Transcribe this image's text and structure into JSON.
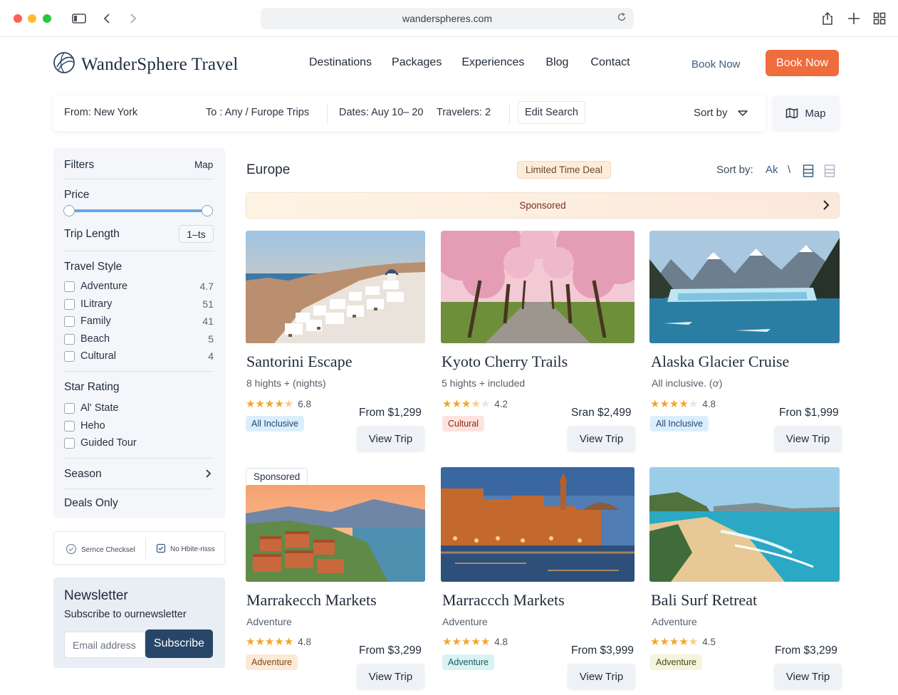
{
  "browser": {
    "url": "wanderspheres.com"
  },
  "header": {
    "logo_text": "WanderSphere Travel",
    "nav": [
      "Destinations",
      "Packages",
      "Experiences",
      "Blog",
      "Contact"
    ],
    "book_link": "Book Now",
    "book_button": "Book Now"
  },
  "search": {
    "from": "From: New York",
    "to": "To : Any / Furope Trips",
    "dates": "Dates:  Auy 10– 20",
    "travelers": "Travelers: 2",
    "edit": "Edit Search",
    "sort": "Sort by",
    "map": "Map"
  },
  "sidebar": {
    "filters": "Filters",
    "map_link": "Map",
    "price": "Price",
    "trip_length": "Trip Length",
    "trip_length_value": "1–ts",
    "travel_style": "Travel Style",
    "styles": [
      {
        "label": "Adventure",
        "count": "4.7"
      },
      {
        "label": "ILitrary",
        "count": "51"
      },
      {
        "label": "Family",
        "count": "41"
      },
      {
        "label": "Beach",
        "count": "5"
      },
      {
        "label": "Cultural",
        "count": "4"
      }
    ],
    "star_rating": "Star Rating",
    "ratings": [
      "Al' State",
      "Heho",
      "Guided Tour"
    ],
    "season": "Season",
    "deals_only": "Deals Only"
  },
  "trust": {
    "left": "Sernce Checksel",
    "right": "No Hbite-risss"
  },
  "newsletter": {
    "title": "Newsletter",
    "subtitle": "Subscribe to ournewsletter",
    "placeholder": "Email address",
    "button": "Subscribe"
  },
  "main": {
    "region": "Europe",
    "deal": "Limited Time Deal",
    "sort_label": "Sort by:",
    "sort_value": "Ak",
    "sort_slash": "\\",
    "sponsored_banner": "Sponsored",
    "sponsored_tab": "Sponsored"
  },
  "cards": [
    {
      "title": "Santorini Escape",
      "sub": "8 hights + (nights)",
      "rating": 4.5,
      "rating_text": "6.8",
      "price": "From $1,299",
      "tag": "All  Inclusive",
      "tag_color": "blue",
      "button": "View Trip"
    },
    {
      "title": "Kyoto Cherry Trails",
      "sub": "5 hights  + included",
      "rating": 3.5,
      "rating_text": "4.2",
      "price": "Sran $2,499",
      "tag": "Cultural",
      "tag_color": "red",
      "button": "View Trip"
    },
    {
      "title": "Alaska Glacier Cruise",
      "sub": "All inclusive.   (ơ)",
      "rating": 4,
      "rating_text": "4.8",
      "price": "Fron $1,999",
      "tag": "All  Inclusive",
      "tag_color": "blue",
      "button": "View Trip"
    },
    {
      "title": "Marrakecch Markets",
      "sub": "Adventure",
      "rating": 5,
      "rating_text": "4.8",
      "price": "From $3,299",
      "tag": "Adventure",
      "tag_color": "orange",
      "button": "View Trip"
    },
    {
      "title": "Marraccch Markets",
      "sub": "Adventure",
      "rating": 5,
      "rating_text": "4.8",
      "price": "From $3,999",
      "tag": "Adventure",
      "tag_color": "teal",
      "button": "View Trip"
    },
    {
      "title": "Bali Surf Retreat",
      "sub": "Adventure",
      "rating": 4.5,
      "rating_text": "4.5",
      "price": "From $3,299",
      "tag": "Adventure",
      "tag_color": "yellow",
      "button": "View Trip"
    }
  ],
  "colors": {
    "accent": "#ef6c3d",
    "navy": "#274567",
    "link": "#3b5a80"
  }
}
